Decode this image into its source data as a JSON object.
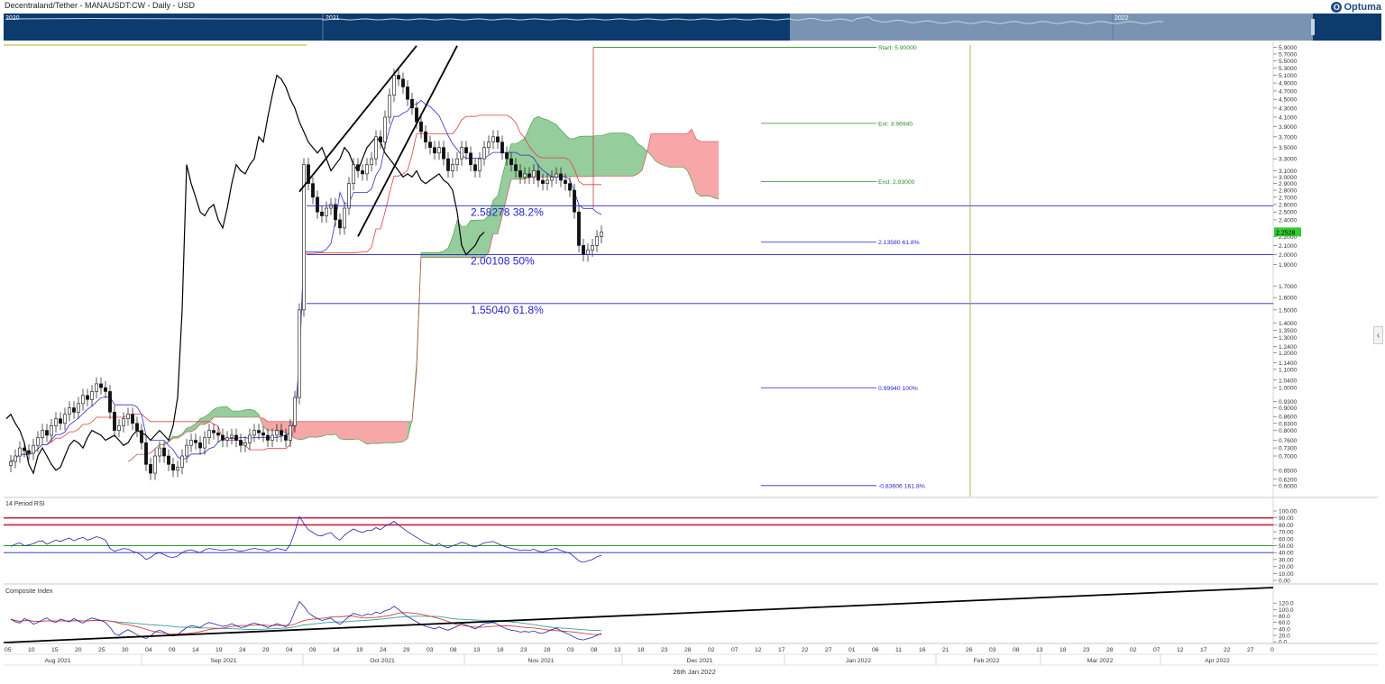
{
  "header": {
    "title": "Decentraland/Tether - MANAUSDT:CW - Daily - USD",
    "brand": "Optuma",
    "brand_mark": "O"
  },
  "navigator": {
    "years": [
      "2020",
      "2021",
      "2022"
    ],
    "bg_color": "#0d3b6e",
    "window_color": "#7a93b3"
  },
  "footer": {
    "date_label": "26th Jan 2022"
  },
  "chart_data": [
    {
      "type": "candlestick",
      "name": "price",
      "scale": "log",
      "ylim": [
        0.58,
        6.0
      ],
      "price_ticks": [
        5.9,
        5.7,
        5.5,
        5.3,
        5.1,
        4.9,
        4.7,
        4.5,
        4.3,
        4.1,
        3.9,
        3.7,
        3.5,
        3.3,
        3.1,
        3.0,
        2.9,
        2.8,
        2.7,
        2.6,
        2.5,
        2.4,
        2.2,
        2.1,
        2.0,
        1.9,
        1.7,
        1.6,
        1.5,
        1.4,
        1.35,
        1.3,
        1.24,
        1.2,
        1.14,
        1.1,
        1.04,
        1.0,
        0.93,
        0.9,
        0.86,
        0.83,
        0.8,
        0.76,
        0.73,
        0.7,
        0.65,
        0.62,
        0.6
      ],
      "price_tick_labels": [
        "5.9000",
        "5.7000",
        "5.5000",
        "5.3000",
        "5.1000",
        "4.9000",
        "4.7000",
        "4.5000",
        "4.3000",
        "4.1000",
        "3.9000",
        "3.7000",
        "3.5000",
        "3.3000",
        "3.1000",
        "3.0000",
        "2.9000",
        "2.8000",
        "2.7000",
        "2.6000",
        "2.5000",
        "2.4000",
        "2.2000",
        "2.1000",
        "2.0000",
        "1.9000",
        "1.7000",
        "1.6000",
        "1.5000",
        "1.4000",
        "1.3500",
        "1.3000",
        "1.2400",
        "1.2000",
        "1.1400",
        "1.1000",
        "1.0400",
        "1.0000",
        "0.9300",
        "0.9000",
        "0.8600",
        "0.8300",
        "0.8000",
        "0.7600",
        "0.7300",
        "0.7000",
        "0.6500",
        "0.6200",
        "0.6000"
      ],
      "last_price": "2.2528",
      "last_price_value": 2.2528,
      "x_day_ticks": [
        "05",
        "10",
        "15",
        "20",
        "25",
        "30",
        "04",
        "09",
        "14",
        "19",
        "24",
        "29",
        "04",
        "09",
        "14",
        "19",
        "24",
        "29",
        "03",
        "08",
        "13",
        "18",
        "23",
        "28",
        "03",
        "08",
        "13",
        "18",
        "23",
        "28",
        "02",
        "07",
        "12",
        "17",
        "22",
        "27",
        "01",
        "06",
        "11",
        "16",
        "21",
        "26",
        "03",
        "08",
        "13",
        "18",
        "23",
        "28",
        "02",
        "07",
        "12",
        "17",
        "22",
        "27",
        "0"
      ],
      "x_months": [
        "Aug 2021",
        "Sep 2021",
        "Oct 2021",
        "Nov 2021",
        "Dec 2021",
        "Jan 2022",
        "Feb 2022",
        "Mar 2022",
        "Apr 2022"
      ],
      "fib_retracements": [
        {
          "price": 2.58278,
          "label": "2.58278",
          "pct": "38.2%"
        },
        {
          "price": 2.00108,
          "label": "2.00108",
          "pct": "50%"
        },
        {
          "price": 1.5504,
          "label": "1.55040",
          "pct": "61.8%"
        }
      ],
      "fib_extension": {
        "start": "Start: 5.90000",
        "start_price": 5.9,
        "ext": "Ext: 3.96940",
        "ext_price": 3.9694,
        "end": "End: 2.93000",
        "end_price": 2.93,
        "levels": [
          {
            "label": "2.13580",
            "pct": "61.8%",
            "price": 2.1358
          },
          {
            "label": "0.99940",
            "pct": "100%",
            "price": 0.9994
          },
          {
            "label": "-0.83606",
            "pct": "161.8%",
            "price": 0.6
          }
        ]
      },
      "close_series": [
        0.68,
        0.7,
        0.73,
        0.72,
        0.71,
        0.74,
        0.77,
        0.8,
        0.78,
        0.82,
        0.85,
        0.83,
        0.87,
        0.9,
        0.88,
        0.92,
        0.96,
        0.94,
        0.98,
        1.02,
        1.0,
        0.98,
        0.88,
        0.8,
        0.82,
        0.85,
        0.87,
        0.83,
        0.8,
        0.75,
        0.67,
        0.64,
        0.7,
        0.73,
        0.7,
        0.67,
        0.65,
        0.66,
        0.7,
        0.74,
        0.76,
        0.75,
        0.73,
        0.77,
        0.8,
        0.79,
        0.78,
        0.76,
        0.77,
        0.78,
        0.76,
        0.74,
        0.75,
        0.78,
        0.8,
        0.79,
        0.78,
        0.76,
        0.78,
        0.8,
        0.78,
        0.76,
        0.82,
        0.95,
        1.5,
        3.2,
        2.9,
        2.7,
        2.5,
        2.45,
        2.55,
        2.6,
        2.4,
        2.3,
        2.55,
        2.9,
        3.2,
        3.1,
        3.05,
        3.2,
        3.3,
        3.7,
        3.6,
        4.1,
        4.6,
        5.1,
        5.0,
        4.8,
        4.5,
        4.3,
        4.0,
        3.8,
        3.6,
        3.5,
        3.4,
        3.5,
        3.3,
        3.1,
        3.2,
        3.3,
        3.5,
        3.4,
        3.2,
        3.1,
        3.3,
        3.5,
        3.6,
        3.7,
        3.6,
        3.4,
        3.3,
        3.2,
        3.1,
        3.0,
        3.05,
        3.0,
        3.1,
        2.95,
        2.9,
        2.95,
        3.0,
        3.05,
        2.95,
        2.9,
        2.8,
        2.5,
        2.1,
        2.0,
        2.05,
        2.1,
        2.2,
        2.25
      ],
      "ichimoku": {
        "kumo_bullish_color": "#2e9c3a",
        "kumo_bearish_color": "#f05050",
        "tenkan_color": "#3030cc",
        "kijun_color": "#e04040",
        "chikou_color": "#000000"
      }
    },
    {
      "type": "line",
      "name": "14 Period RSI",
      "title": "14 Period RSI",
      "ylim": [
        0,
        100
      ],
      "y_ticks": [
        100,
        90,
        80,
        70,
        60,
        50,
        40,
        30,
        20,
        10,
        0
      ],
      "y_tick_labels": [
        "100.00",
        "90.00",
        "80.00",
        "70.00",
        "60.00",
        "50.00",
        "40.00",
        "30.00",
        "20.00",
        "10.00",
        "0.00"
      ],
      "levels": [
        90,
        80,
        50,
        40
      ],
      "values": [
        49,
        52,
        54,
        50,
        51,
        53,
        56,
        57,
        52,
        55,
        58,
        56,
        59,
        61,
        57,
        60,
        62,
        58,
        60,
        63,
        61,
        58,
        46,
        42,
        44,
        46,
        45,
        42,
        40,
        36,
        30,
        33,
        38,
        40,
        37,
        34,
        33,
        35,
        40,
        43,
        44,
        42,
        40,
        44,
        46,
        45,
        44,
        43,
        44,
        45,
        43,
        42,
        43,
        45,
        46,
        45,
        44,
        42,
        44,
        46,
        45,
        43,
        52,
        70,
        92,
        82,
        73,
        69,
        65,
        64,
        67,
        69,
        62,
        58,
        65,
        70,
        74,
        71,
        69,
        72,
        72,
        76,
        73,
        78,
        81,
        85,
        80,
        75,
        70,
        66,
        62,
        58,
        54,
        52,
        50,
        53,
        49,
        47,
        50,
        52,
        55,
        53,
        50,
        48,
        51,
        54,
        55,
        56,
        53,
        50,
        48,
        46,
        45,
        43,
        44,
        43,
        45,
        42,
        41,
        43,
        45,
        46,
        43,
        41,
        39,
        34,
        28,
        26,
        28,
        30,
        34,
        36
      ]
    },
    {
      "type": "line",
      "name": "Composite Index",
      "title": "Composite Index",
      "ylim": [
        -5,
        140
      ],
      "y_ticks": [
        120,
        100,
        80,
        60,
        40,
        20,
        0
      ],
      "y_tick_labels": [
        "120.0",
        "100.0",
        "80.0",
        "60.0",
        "40.0",
        "20.0",
        "0.0"
      ],
      "values": [
        70,
        62,
        58,
        72,
        66,
        55,
        60,
        68,
        74,
        64,
        60,
        70,
        66,
        62,
        72,
        64,
        58,
        68,
        74,
        70,
        66,
        60,
        45,
        25,
        20,
        30,
        38,
        30,
        22,
        15,
        10,
        18,
        30,
        36,
        30,
        22,
        18,
        22,
        34,
        44,
        50,
        48,
        44,
        54,
        60,
        56,
        52,
        48,
        50,
        56,
        50,
        44,
        46,
        54,
        58,
        54,
        50,
        44,
        50,
        56,
        52,
        46,
        60,
        95,
        125,
        110,
        90,
        80,
        72,
        66,
        70,
        74,
        62,
        54,
        66,
        78,
        88,
        84,
        80,
        86,
        84,
        92,
        88,
        96,
        100,
        110,
        100,
        88,
        78,
        70,
        62,
        54,
        48,
        44,
        40,
        46,
        40,
        36,
        42,
        48,
        56,
        52,
        46,
        40,
        48,
        56,
        58,
        60,
        54,
        46,
        40,
        36,
        34,
        30,
        32,
        30,
        34,
        28,
        26,
        32,
        38,
        42,
        34,
        28,
        22,
        14,
        8,
        6,
        10,
        14,
        20,
        26
      ]
    }
  ]
}
